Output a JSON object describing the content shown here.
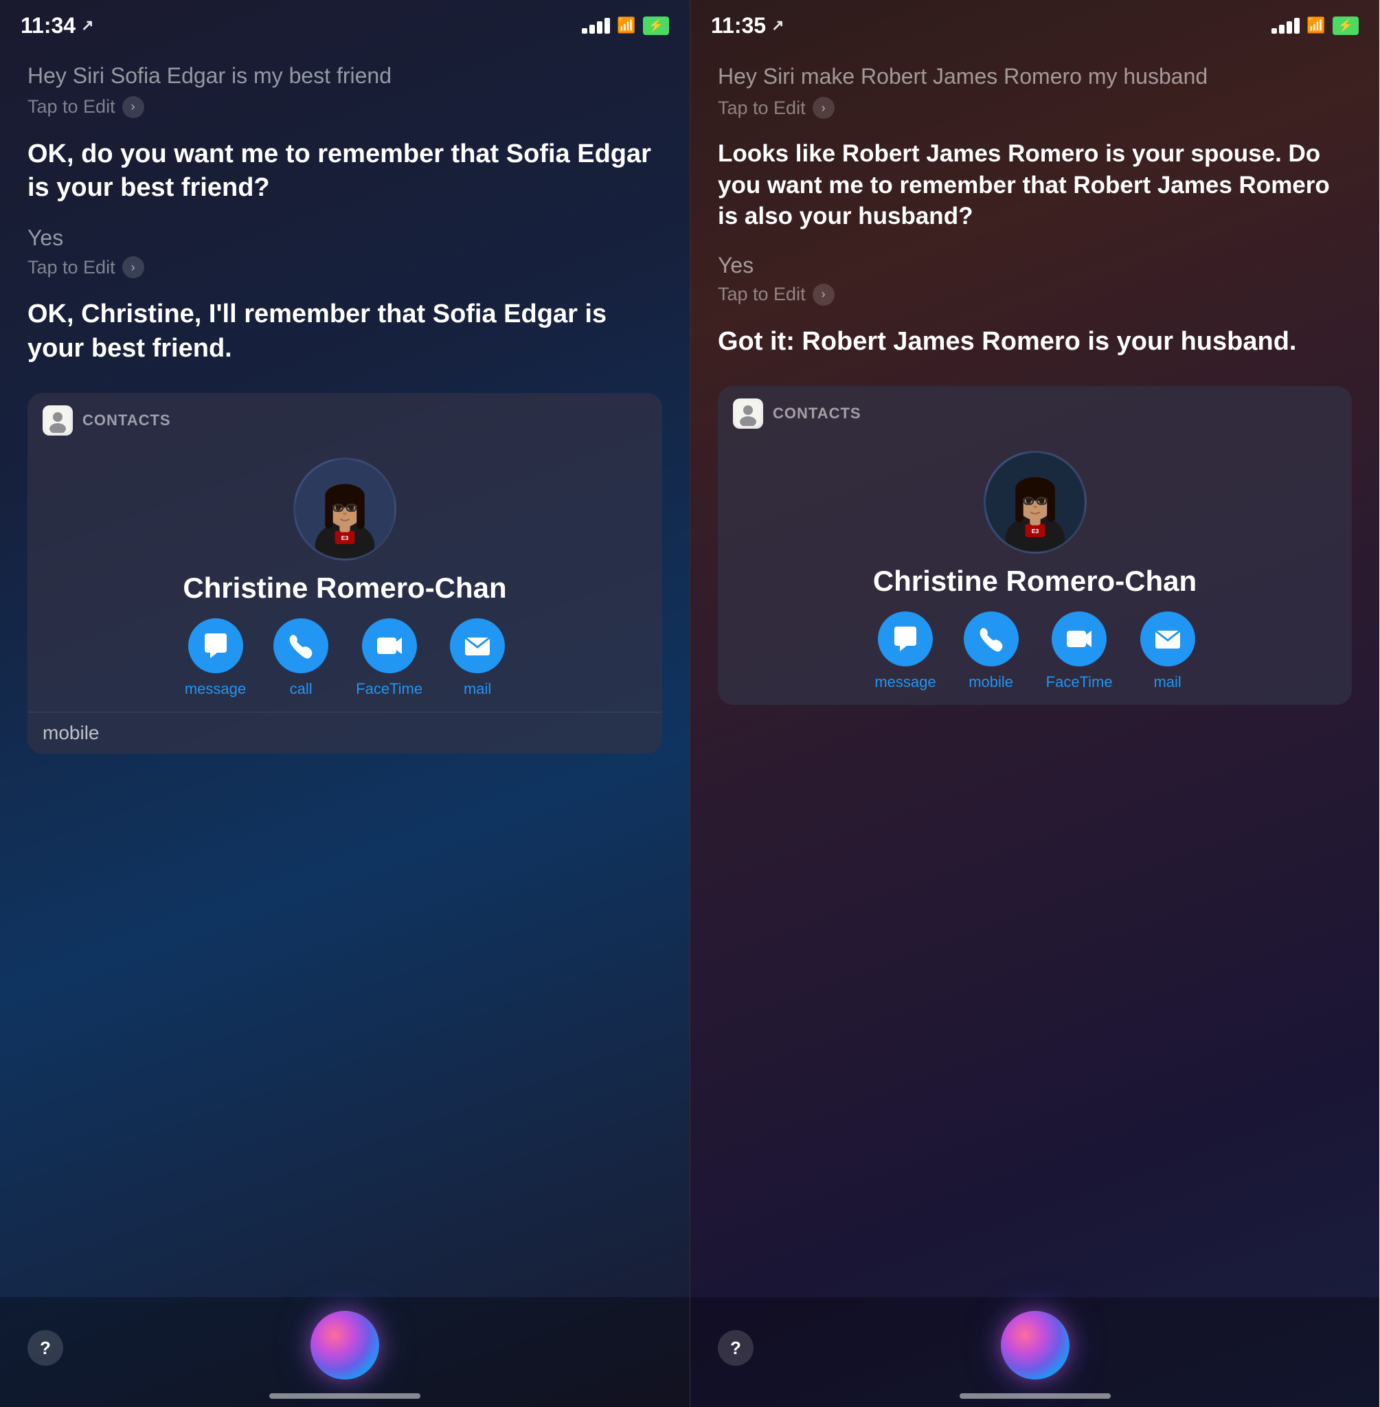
{
  "left": {
    "statusBar": {
      "time": "11:34",
      "locationIcon": "↗",
      "signalBars": [
        8,
        12,
        16,
        20
      ],
      "batteryText": "⚡"
    },
    "query1": "Hey Siri Sofia Edgar is my best friend",
    "tapToEdit1": "Tap to Edit",
    "response1": "OK, do you want me to remember that Sofia Edgar is your best friend?",
    "userReply": "Yes",
    "tapToEdit2": "Tap to Edit",
    "response2": "OK, Christine, I'll remember that Sofia Edgar is your best friend.",
    "contactsLabel": "CONTACTS",
    "contactName": "Christine Romero-Chan",
    "actions": [
      {
        "icon": "💬",
        "label": "message"
      },
      {
        "icon": "📞",
        "label": "call"
      },
      {
        "icon": "📹",
        "label": "FaceTime"
      },
      {
        "icon": "✉️",
        "label": "mail"
      }
    ],
    "mobileLabel": "mobile"
  },
  "right": {
    "statusBar": {
      "time": "11:35",
      "locationIcon": "↗",
      "batteryText": "⚡"
    },
    "query1": "Hey Siri make Robert James Romero my husband",
    "tapToEdit1": "Tap to Edit",
    "response1": "Looks like Robert James Romero is your spouse. Do you want me to remember that Robert James Romero is also your husband?",
    "userReply": "Yes",
    "tapToEdit2": "Tap to Edit",
    "response2": "Got it: Robert James Romero is your husband.",
    "contactsLabel": "CONTACTS",
    "contactName": "Christine Romero-Chan",
    "actions": [
      {
        "icon": "💬",
        "label": "message"
      },
      {
        "icon": "📞",
        "label": "mobile"
      },
      {
        "icon": "📹",
        "label": "FaceTime"
      },
      {
        "icon": "✉️",
        "label": "mail"
      }
    ]
  }
}
